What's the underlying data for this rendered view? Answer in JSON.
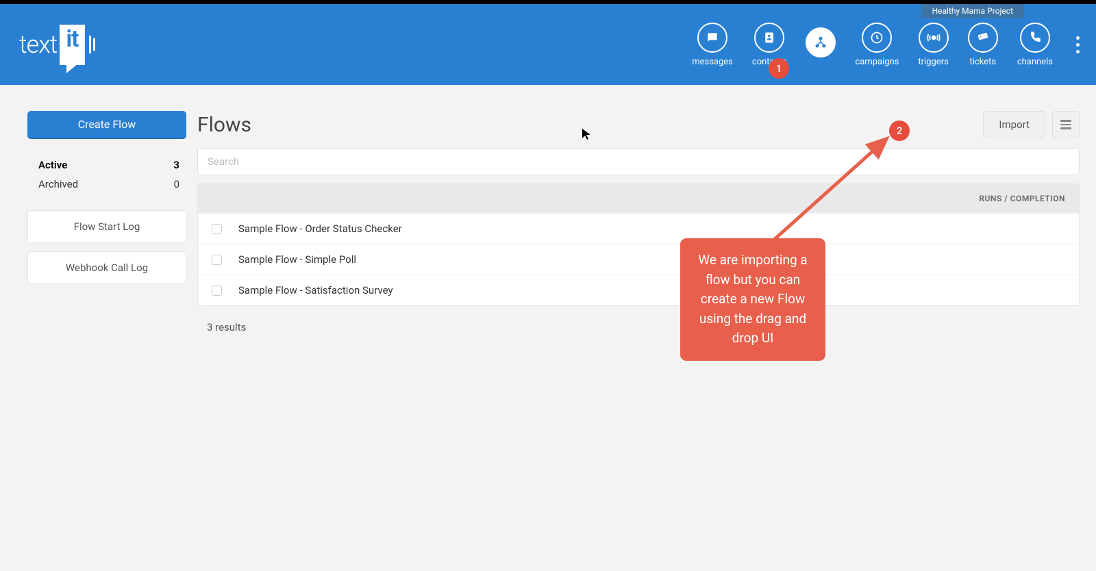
{
  "project_name": "Healthy Mama Project",
  "logo": {
    "text_left": "text",
    "text_box": "it"
  },
  "nav": [
    {
      "key": "messages",
      "label": "messages"
    },
    {
      "key": "contacts",
      "label": "contacts"
    },
    {
      "key": "flows",
      "label": "",
      "active": true
    },
    {
      "key": "campaigns",
      "label": "campaigns"
    },
    {
      "key": "triggers",
      "label": "triggers"
    },
    {
      "key": "tickets",
      "label": "tickets"
    },
    {
      "key": "channels",
      "label": "channels"
    }
  ],
  "badges": {
    "b1": "1",
    "b2": "2"
  },
  "sidebar": {
    "create_label": "Create Flow",
    "stats": [
      {
        "label": "Active",
        "count": "3",
        "active": true
      },
      {
        "label": "Archived",
        "count": "0",
        "active": false
      }
    ],
    "buttons": [
      {
        "label": "Flow Start Log"
      },
      {
        "label": "Webhook Call Log"
      }
    ]
  },
  "main": {
    "title": "Flows",
    "import_label": "Import",
    "search_placeholder": "Search",
    "table_header": "RUNS / COMPLETION",
    "rows": [
      {
        "label": "Sample Flow - Order Status Checker"
      },
      {
        "label": "Sample Flow - Simple Poll"
      },
      {
        "label": "Sample Flow - Satisfaction Survey"
      }
    ],
    "results_text": "3 results"
  },
  "callout_text": "We are importing a flow but you can create a new Flow using the drag and drop UI"
}
